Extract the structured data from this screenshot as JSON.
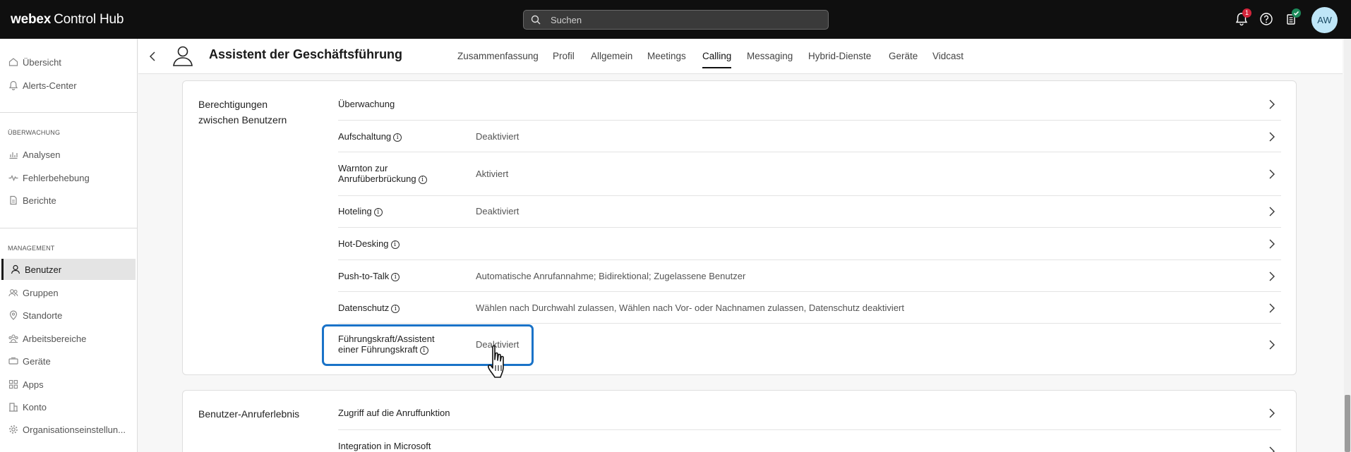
{
  "topbar": {
    "brand_bold": "webex",
    "brand_rest": "Control Hub",
    "search_placeholder": "Suchen",
    "notification_count": "1",
    "avatar_initials": "AW"
  },
  "sidebar": {
    "top_items": [
      {
        "label": "Übersicht",
        "icon": "home-icon"
      },
      {
        "label": "Alerts-Center",
        "icon": "bell-icon"
      }
    ],
    "section_monitoring": "ÜBERWACHUNG",
    "monitoring_items": [
      {
        "label": "Analysen",
        "icon": "chart-icon"
      },
      {
        "label": "Fehlerbehebung",
        "icon": "pulse-icon"
      },
      {
        "label": "Berichte",
        "icon": "document-icon"
      }
    ],
    "section_management": "MANAGEMENT",
    "management_items": [
      {
        "label": "Benutzer",
        "icon": "user-icon",
        "active": true
      },
      {
        "label": "Gruppen",
        "icon": "group-icon"
      },
      {
        "label": "Standorte",
        "icon": "location-icon"
      },
      {
        "label": "Arbeitsbereiche",
        "icon": "workspace-icon"
      },
      {
        "label": "Geräte",
        "icon": "device-icon"
      },
      {
        "label": "Apps",
        "icon": "apps-icon"
      },
      {
        "label": "Konto",
        "icon": "building-icon"
      },
      {
        "label": "Organisationseinstellun...",
        "icon": "gear-icon"
      }
    ]
  },
  "header": {
    "title": "Assistent der Geschäftsführung",
    "tabs": [
      {
        "label": "Zusammenfassung"
      },
      {
        "label": "Profil"
      },
      {
        "label": "Allgemein"
      },
      {
        "label": "Meetings"
      },
      {
        "label": "Calling",
        "active": true
      },
      {
        "label": "Messaging"
      },
      {
        "label": "Hybrid-Dienste"
      },
      {
        "label": "Geräte"
      },
      {
        "label": "Vidcast"
      }
    ]
  },
  "permissions_card": {
    "title": "Berechtigungen zwischen Benutzern",
    "rows": [
      {
        "label": "Überwachung",
        "info": false,
        "value": ""
      },
      {
        "label": "Aufschaltung",
        "info": true,
        "value": "Deaktiviert"
      },
      {
        "label": "Warnton zur Anrufüberbrückung",
        "info": true,
        "value": "Aktiviert"
      },
      {
        "label": "Hoteling",
        "info": true,
        "value": "Deaktiviert"
      },
      {
        "label": "Hot-Desking",
        "info": true,
        "value": ""
      },
      {
        "label": "Push-to-Talk",
        "info": true,
        "value": "Automatische Anrufannahme; Bidirektional; Zugelassene Benutzer"
      },
      {
        "label": "Datenschutz",
        "info": true,
        "value": "Wählen nach Durchwahl zulassen, Wählen nach Vor- oder Nachnamen zulassen, Datenschutz deaktiviert"
      },
      {
        "label": "Führungskraft/Assistent einer Führungskraft",
        "info": true,
        "value": "Deaktiviert"
      }
    ]
  },
  "experience_card": {
    "title": "Benutzer-Anruferlebnis",
    "rows": [
      {
        "label": "Zugriff auf die Anruffunktion",
        "value": ""
      },
      {
        "label": "Integration in Microsoft",
        "value": ""
      }
    ]
  },
  "colors": {
    "topbar_bg": "#0f0f0f",
    "highlight": "#1a73c8",
    "badge_red": "#d4253b",
    "badge_green": "#1d8a5b",
    "avatar_bg": "#bfe6f7"
  }
}
